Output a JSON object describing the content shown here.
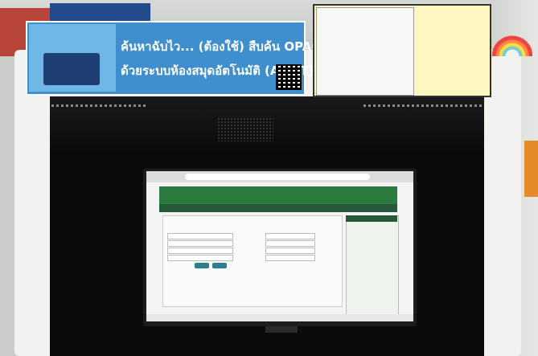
{
  "banner": {
    "line1": "ค้นหาฉับไว... (ต้องใช้) สืบค้น OPAC",
    "line2": "ด้วยระบบห้องสมุดอัตโนมัติ (ALIST)"
  },
  "colors": {
    "banner": "#3f8fcf",
    "poster": "#fff7c2",
    "kiosk": "#f2f2f0",
    "site_header": "#2b7a3e"
  }
}
